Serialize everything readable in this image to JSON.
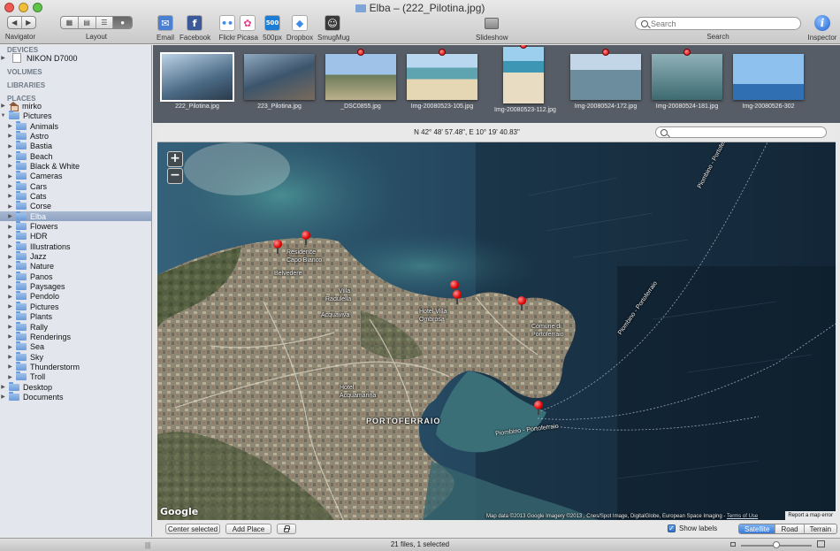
{
  "window": {
    "title": "Elba – (222_Pilotina.jpg)"
  },
  "toolbar": {
    "navigator_label": "Navigator",
    "layout_label": "Layout",
    "share": [
      {
        "label": "Email",
        "icon": "email-icon",
        "color": "#4b7fd1",
        "glyph": "✉"
      },
      {
        "label": "Facebook",
        "icon": "facebook-icon",
        "color": "#3b5998",
        "glyph": "f"
      },
      {
        "label": "Flickr",
        "icon": "flickr-icon",
        "color": "#ffffff",
        "glyph": "••"
      },
      {
        "label": "Picasa",
        "icon": "picasa-icon",
        "color": "#ffffff",
        "glyph": "✿"
      },
      {
        "label": "500px",
        "icon": "500px-icon",
        "color": "#1d7dd4",
        "glyph": "500"
      },
      {
        "label": "Dropbox",
        "icon": "dropbox-icon",
        "color": "#ffffff",
        "glyph": "◆"
      },
      {
        "label": "SmugMug",
        "icon": "smugmug-icon",
        "color": "#3a3a3a",
        "glyph": "☺"
      }
    ],
    "slideshow_label": "Slideshow",
    "search_placeholder": "Search",
    "search_label": "Search",
    "inspector_label": "Inspector"
  },
  "sidebar": {
    "devices_header": "DEVICES",
    "device": "NIKON D7000",
    "volumes_header": "VOLUMES",
    "libraries_header": "LIBRARIES",
    "places_header": "PLACES",
    "home": "mirko",
    "pictures": "Pictures",
    "folders": [
      "Animals",
      "Astro",
      "Bastia",
      "Beach",
      "Black & White",
      "Cameras",
      "Cars",
      "Cats",
      "Corse",
      "Elba",
      "Flowers",
      "HDR",
      "Illustrations",
      "Jazz",
      "Nature",
      "Panos",
      "Paysages",
      "Pendolo",
      "Pictures",
      "Plants",
      "Rally",
      "Renderings",
      "Sea",
      "Sky",
      "Thunderstorm",
      "Troll"
    ],
    "selected": "Elba",
    "desktop": "Desktop",
    "documents": "Documents"
  },
  "thumbnails": [
    {
      "name": "222_Pilotina.jpg",
      "selected": true,
      "pin": false
    },
    {
      "name": "223_Pilotina.jpg",
      "selected": false,
      "pin": false
    },
    {
      "name": "_DSC0855.jpg",
      "selected": false,
      "pin": true
    },
    {
      "name": "Img-20080523-105.jpg",
      "selected": false,
      "pin": true
    },
    {
      "name": "Img-20080523-112.jpg",
      "selected": false,
      "pin": true
    },
    {
      "name": "Img-20080524-172.jpg",
      "selected": false,
      "pin": true
    },
    {
      "name": "Img-20080524-181.jpg",
      "selected": false,
      "pin": true
    },
    {
      "name": "Img-20080526-302",
      "selected": false,
      "pin": false
    }
  ],
  "map": {
    "coordinates": "N 42° 48' 57.48\", E 10° 19' 40.83\"",
    "zoom_in": "+",
    "zoom_out": "−",
    "labels": {
      "city": "PORTOFERRAIO",
      "ferry_route_1": "Piombino - Portoferraio",
      "ferry_route_2": "Piombino - Portoferraio",
      "ferry_route_3": "Piombino - Portoferraio",
      "residence": "Residence",
      "residence2": "Capo Bianco",
      "belvedere": "Belvedere",
      "villa": "Villa",
      "radulella": "Radulella",
      "acquaviva": "Acquaviva",
      "hotel": "Hotel Villa",
      "hotel2": "Ombrosa",
      "comune": "Comune di",
      "comune2": "Portoferraio",
      "hotel_ap": "Hotel",
      "hotel_ap2": "Acquamarina"
    },
    "google": "Google",
    "attribution": "Map data ©2013 Google Imagery ©2013 , Cnes/Spot Image, DigitalGlobe, European Space Imaging -",
    "terms": "Terms of Use",
    "report": "Report a map error"
  },
  "map_controls": {
    "center_selected": "Center selected",
    "add_place": "Add Place",
    "show_labels": "Show labels",
    "show_labels_checked": true,
    "types": [
      "Satellite",
      "Road",
      "Terrain"
    ],
    "active_type": "Satellite"
  },
  "status": {
    "text": "21 files, 1 selected"
  }
}
